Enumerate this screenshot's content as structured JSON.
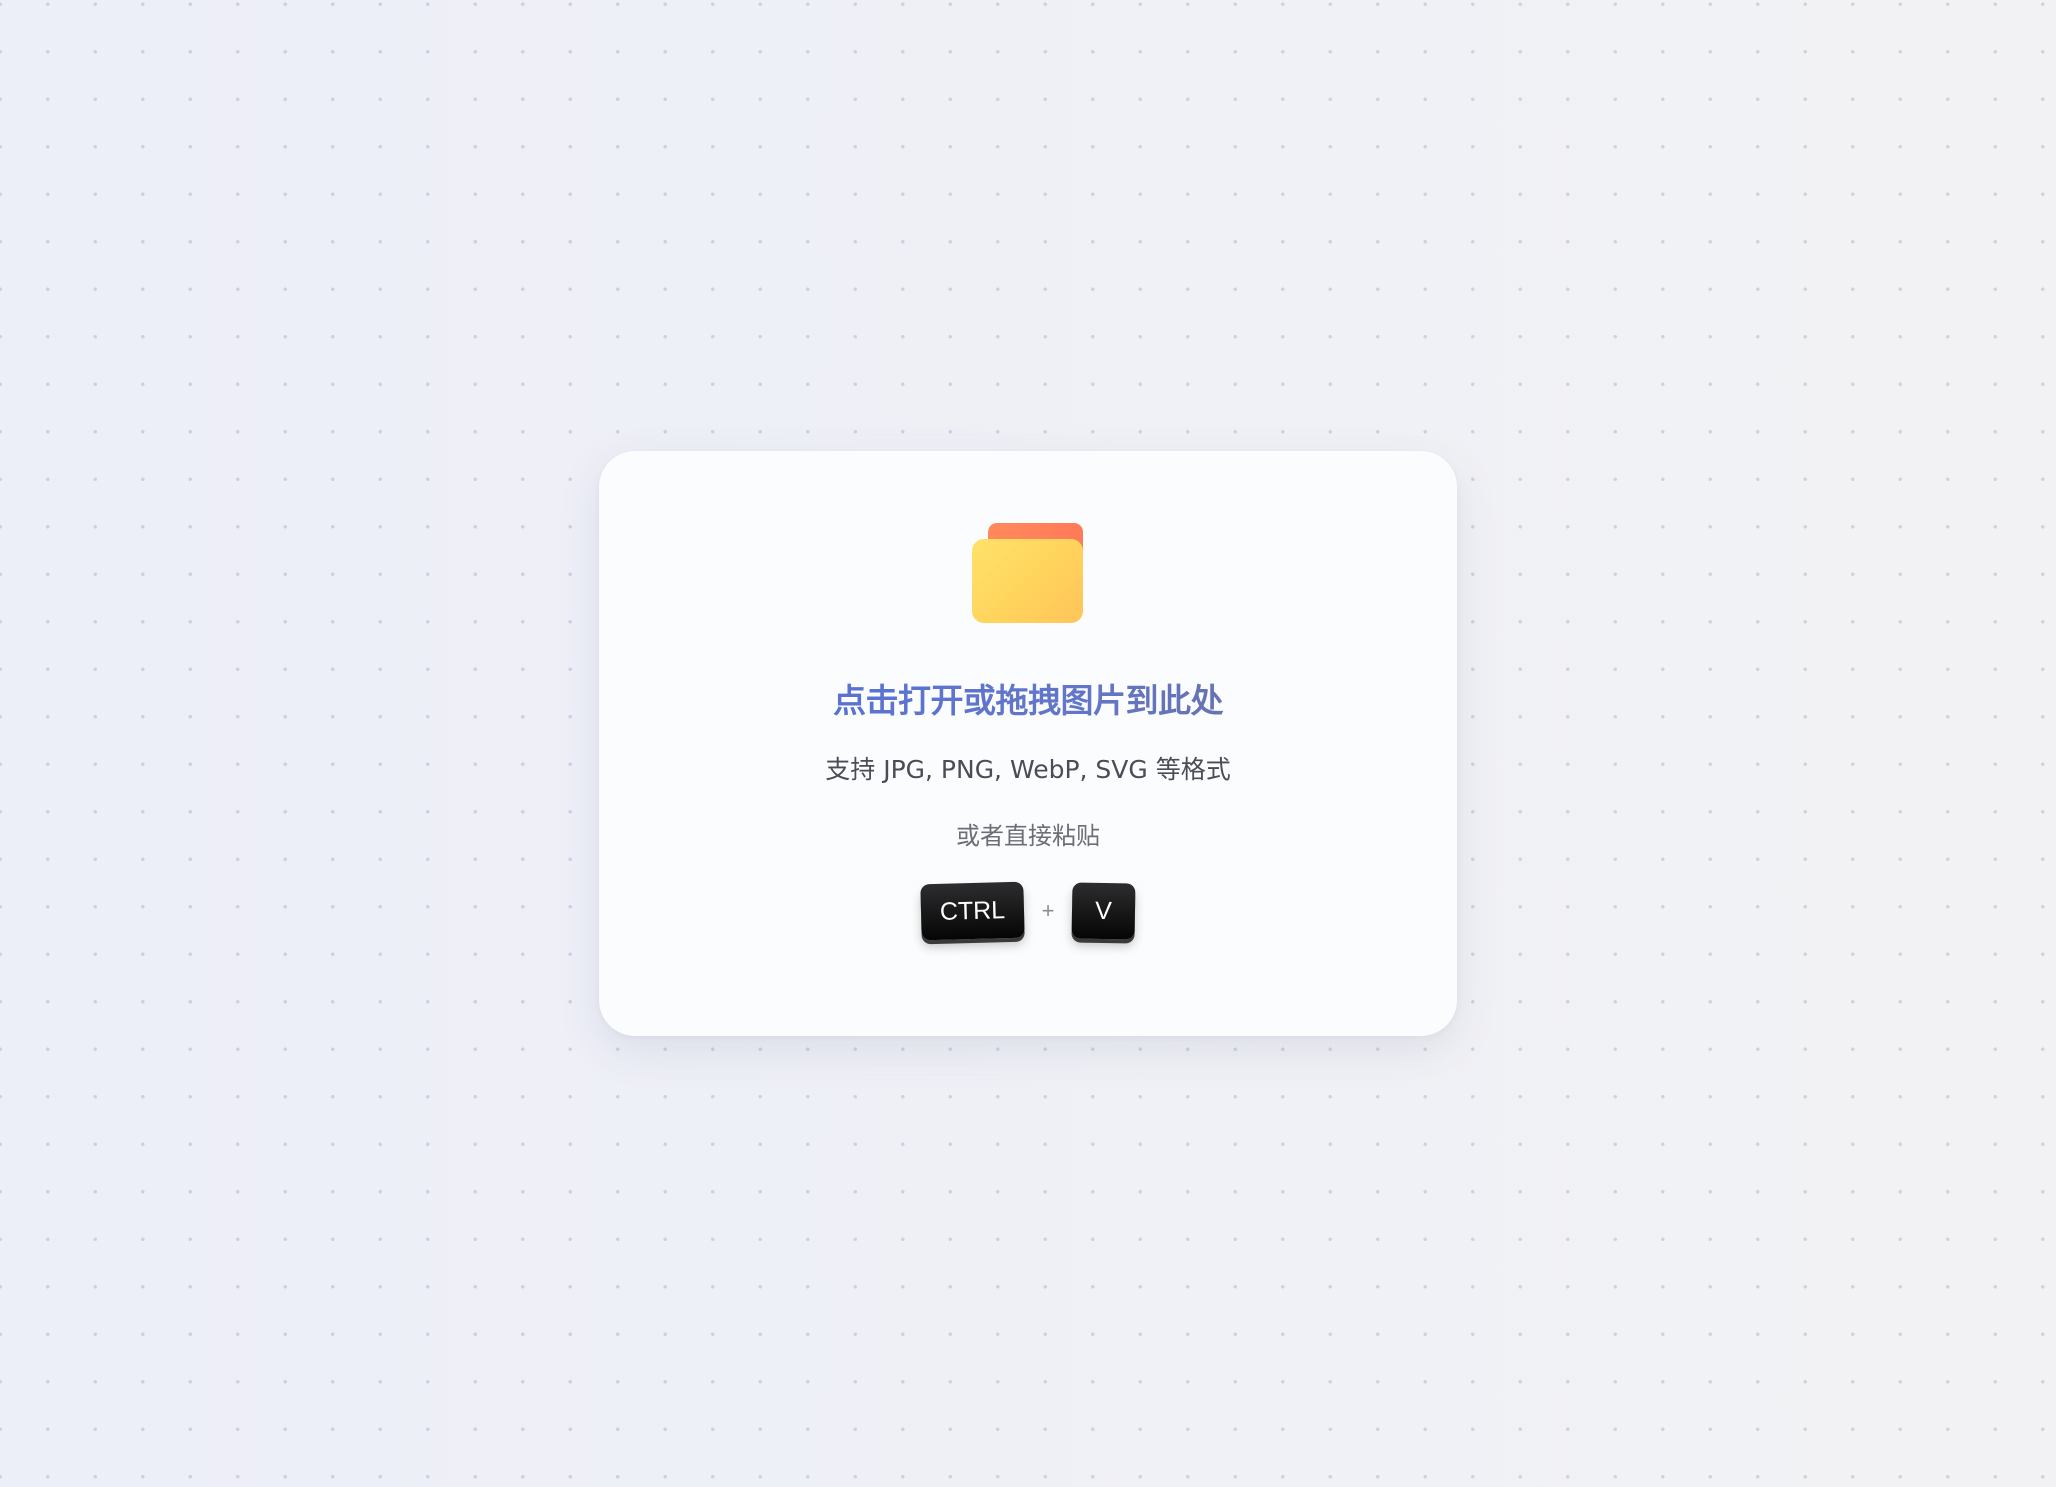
{
  "dropzone": {
    "icon": "folder-icon",
    "title": "点击打开或拖拽图片到此处",
    "formats": "支持 JPG, PNG, WebP, SVG 等格式",
    "paste_hint": "或者直接粘贴",
    "shortcut": {
      "key1": "CTRL",
      "separator": "+",
      "key2": "V"
    }
  },
  "colors": {
    "title_gradient_start": "#4f6fdc",
    "title_gradient_end": "#6a7090",
    "folder_front": "#ffd35c",
    "folder_back": "#ff7a58",
    "key_background": "#111112"
  }
}
